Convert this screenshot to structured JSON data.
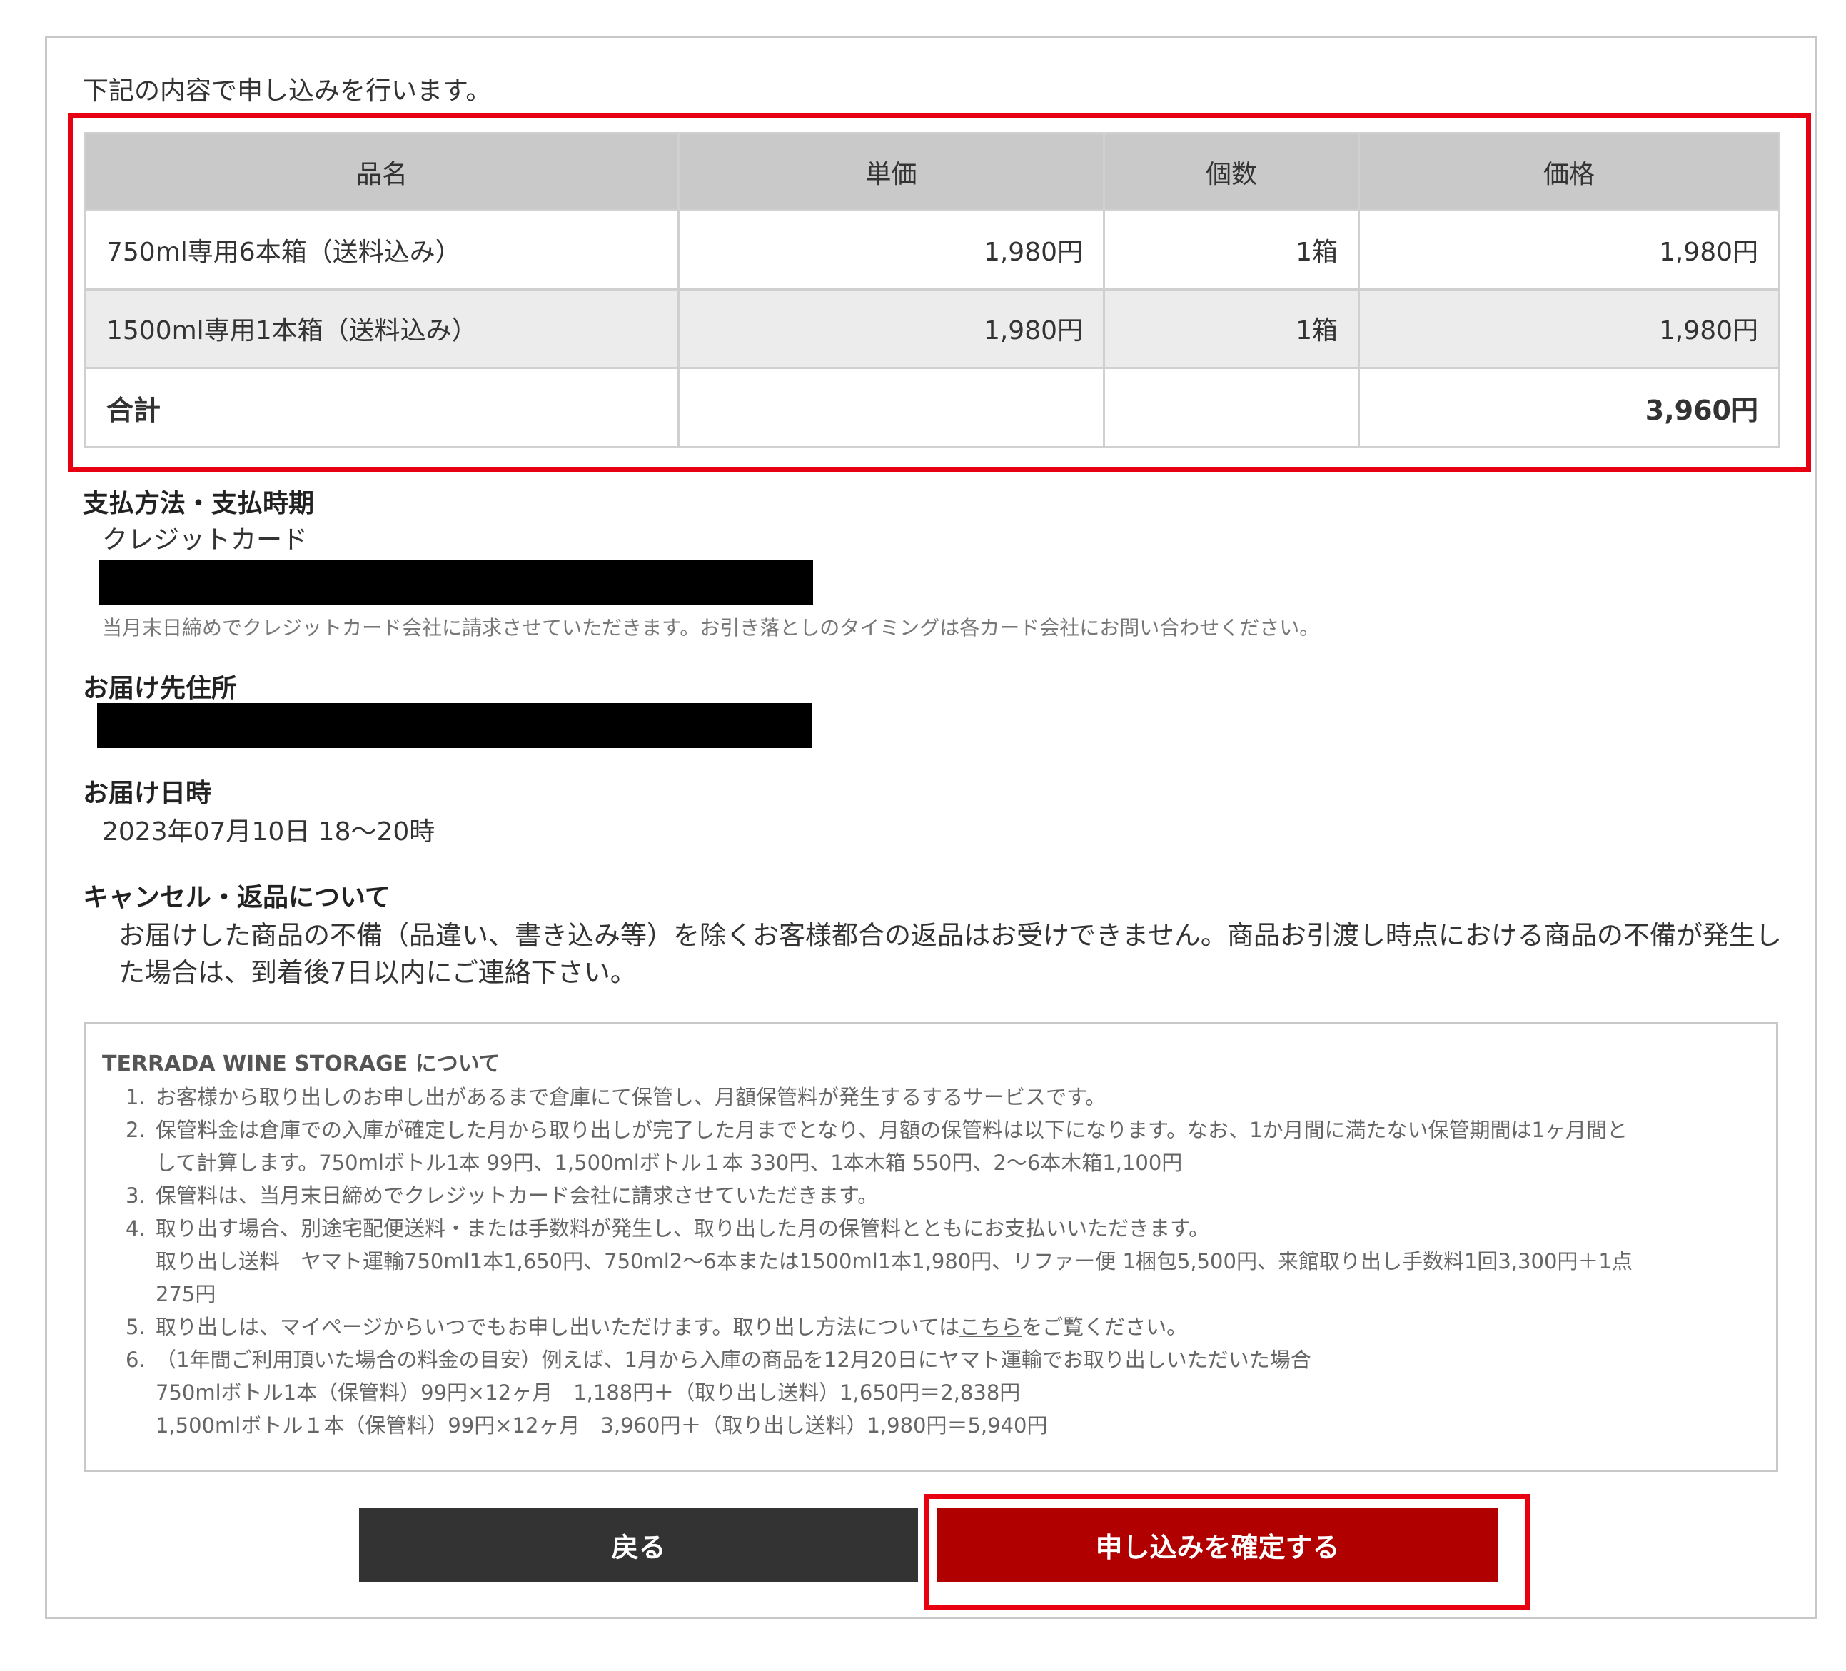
{
  "intro": "下記の内容で申し込みを行います。",
  "order_table": {
    "headers": [
      "品名",
      "単価",
      "個数",
      "価格"
    ],
    "rows": [
      {
        "name": "750ml専用6本箱（送料込み）",
        "unit_price": "1,980円",
        "qty": "1箱",
        "price": "1,980円"
      },
      {
        "name": "1500ml専用1本箱（送料込み）",
        "unit_price": "1,980円",
        "qty": "1箱",
        "price": "1,980円"
      }
    ],
    "total_label": "合計",
    "total_price": "3,960円"
  },
  "payment": {
    "title": "支払方法・支払時期",
    "method": "クレジットカード",
    "note": "当月末日締めでクレジットカード会社に請求させていただきます。お引き落としのタイミングは各カード会社にお問い合わせください。"
  },
  "address": {
    "title": "お届け先住所"
  },
  "delivery": {
    "title": "お届け日時",
    "datetime": "2023年07月10日 18～20時"
  },
  "cancel": {
    "title": "キャンセル・返品について",
    "text": "お届けした商品の不備（品違い、書き込み等）を除くお客様都合の返品はお受けできません。商品お引渡し時点における商品の不備が発生した場合は、到着後7日以内にご連絡下さい。"
  },
  "about": {
    "title": "TERRADA WINE STORAGE について",
    "items": [
      {
        "num": "1.",
        "lines": [
          "お客様から取り出しのお申し出があるまで倉庫にて保管し、月額保管料が発生するするサービスです。"
        ]
      },
      {
        "num": "2.",
        "lines": [
          "保管料金は倉庫での入庫が確定した月から取り出しが完了した月までとなり、月額の保管料は以下になります。なお、1か月間に満たない保管期間は1ヶ月間と",
          "して計算します。750mlボトル1本 99円、1,500mlボトル１本 330円、1本木箱 550円、2～6本木箱1,100円"
        ]
      },
      {
        "num": "3.",
        "lines": [
          "保管料は、当月末日締めでクレジットカード会社に請求させていただきます。"
        ]
      },
      {
        "num": "4.",
        "lines": [
          "取り出す場合、別途宅配便送料・または手数料が発生し、取り出した月の保管料とともにお支払いいただきます。",
          "取り出し送料　ヤマト運輸750ml1本1,650円、750ml2～6本または1500ml1本1,980円、リファー便 1梱包5,500円、来館取り出し手数料1回3,300円＋1点",
          "275円"
        ]
      },
      {
        "num": "5.",
        "pre": "取り出しは、マイページからいつでもお申し出いただけます。取り出し方法については",
        "link": "こちら",
        "post": "をご覧ください。"
      },
      {
        "num": "6.",
        "lines": [
          "（1年間ご利用頂いた場合の料金の目安）例えば、1月から入庫の商品を12月20日にヤマト運輸でお取り出しいただいた場合",
          "750mlボトル1本（保管料）99円×12ヶ月　1,188円＋（取り出し送料）1,650円＝2,838円",
          "1,500mlボトル１本（保管料）99円×12ヶ月　3,960円＋（取り出し送料）1,980円＝5,940円"
        ]
      }
    ]
  },
  "buttons": {
    "back": "戻る",
    "confirm": "申し込みを確定する"
  },
  "colors": {
    "highlight": "#e60012",
    "confirm_button": "#b00000",
    "back_button": "#333333",
    "header_bg": "#c9c9c9"
  }
}
